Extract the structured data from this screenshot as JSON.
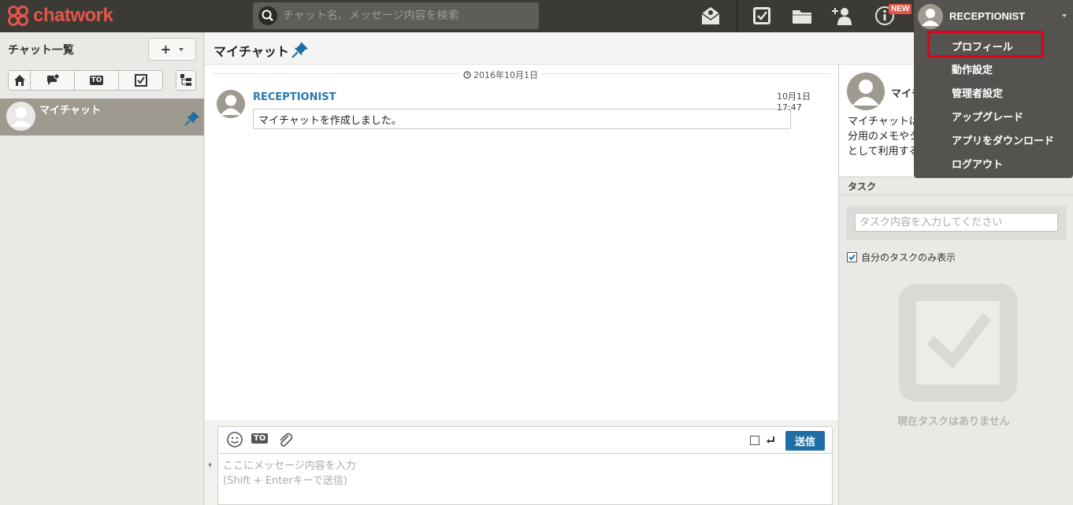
{
  "app": {
    "brand": "chatwork",
    "brand_color": "#e5544a"
  },
  "search": {
    "placeholder": "チャット名、メッセージ内容を検索"
  },
  "topbar": {
    "icons": [
      "contact-inbox-icon",
      "task-icon",
      "folder-icon",
      "add-contact-icon",
      "info-icon"
    ],
    "new_badge": "NEW",
    "user_name": "RECEPTIONIST"
  },
  "user_menu": {
    "items": [
      "プロフィール",
      "動作設定",
      "管理者設定",
      "アップグレード",
      "アプリをダウンロード",
      "ログアウト"
    ],
    "highlighted": "プロフィール"
  },
  "sidebar": {
    "title": "チャット一覧",
    "add_label": "+",
    "filters": [
      "home-icon",
      "unread-icon",
      "to-icon",
      "task-icon"
    ],
    "to_label": "TO",
    "rooms": [
      {
        "name": "マイチャット",
        "pinned": true
      }
    ]
  },
  "chat": {
    "title": "マイチャット",
    "date_label": "2016年10月1日",
    "messages": [
      {
        "user": "RECEPTIONIST",
        "time": "10月1日 17:47",
        "body": "マイチャットを作成しました。"
      }
    ],
    "composer": {
      "to_label": "TO",
      "send_label": "送信",
      "placeholder_line1": "ここにメッセージ内容を入力",
      "placeholder_line2": "(Shift + Enterキーで送信)"
    }
  },
  "right_panel": {
    "room_name": "マイチ",
    "description_lines": [
      "マイチャットは",
      "分用のメモやタ",
      "として利用する"
    ],
    "task_heading": "タスク",
    "task_placeholder": "タスク内容を入力してください",
    "my_tasks_only": "自分のタスクのみ表示",
    "my_tasks_only_checked": true,
    "empty_text": "現在タスクはありません"
  },
  "colors": {
    "topbar": "#3b3a35",
    "accent_blue": "#1f6fa6",
    "highlight_red": "#e3001b"
  }
}
